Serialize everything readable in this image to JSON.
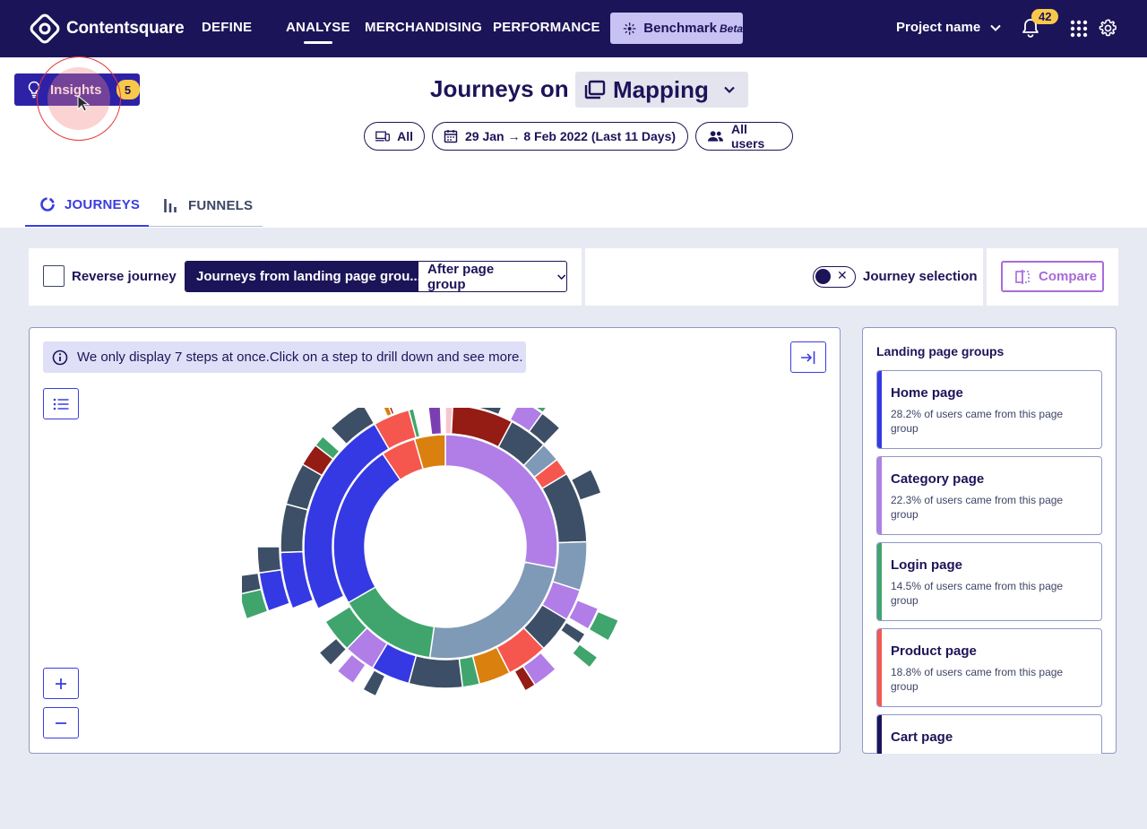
{
  "brand": {
    "name": "Contentsquare"
  },
  "nav": {
    "items": [
      "DEFINE",
      "ANALYSE",
      "MERCHANDISING",
      "PERFORMANCE"
    ],
    "active": "ANALYSE",
    "benchmark": {
      "label": "Benchmark",
      "tag": "Beta"
    },
    "project": "Project name",
    "notification_count": "42"
  },
  "insights": {
    "label": "Insights",
    "count": "5"
  },
  "header": {
    "title_prefix": "Journeys on",
    "mapping_label": "Mapping",
    "filters": {
      "device": "All",
      "date": "29 Jan → 8 Feb 2022 (Last 11 Days)",
      "segment": "All users"
    }
  },
  "tabs": {
    "journeys": "JOURNEYS",
    "funnels": "FUNNELS",
    "active": "JOURNEYS"
  },
  "toolbar": {
    "reverse_label": "Reverse journey",
    "journeys_from": "Journeys from landing page grou...",
    "after": "After page group",
    "journey_selection": "Journey selection",
    "compare": "Compare"
  },
  "info": {
    "message": "We only display 7 steps at once.Click on a step to drill down and see more."
  },
  "side": {
    "title": "Landing page groups",
    "groups": [
      {
        "name": "Home page",
        "desc": "28.2% of users came from this page group",
        "color": "#3539e3"
      },
      {
        "name": "Category page",
        "desc": "22.3% of users came from this page group",
        "color": "#b07ee6"
      },
      {
        "name": "Login page",
        "desc": "14.5% of users came from this page group",
        "color": "#3fa56c"
      },
      {
        "name": "Product page",
        "desc": "18.8% of users came from this page group",
        "color": "#f5574f"
      },
      {
        "name": "Cart page",
        "desc": "",
        "color": "#1c1458"
      }
    ]
  },
  "colors": {
    "nav_bg": "#1c1458",
    "accent": "#3a3ee0",
    "purple": "#a96bd8",
    "badge": "#f9c84a",
    "slate": "#3d4f66",
    "grey_blue": "#7f9ab6",
    "maroon": "#941c15",
    "orange": "#d9800f"
  },
  "sunburst": {
    "rings": [
      {
        "inner": 90,
        "outer": 125,
        "segments": [
          {
            "start": 0,
            "end": 101,
            "color": "#b07ee6"
          },
          {
            "start": 101,
            "end": 188,
            "color": "#7f9ab6"
          },
          {
            "start": 188,
            "end": 240,
            "color": "#3fa56c"
          },
          {
            "start": 240,
            "end": 326,
            "color": "#3539e3"
          },
          {
            "start": 326,
            "end": 344,
            "color": "#f5574f"
          },
          {
            "start": 344,
            "end": 360,
            "color": "#d9800f"
          }
        ]
      },
      {
        "inner": 126,
        "outer": 158,
        "segments": [
          {
            "start": 0,
            "end": 3,
            "color": "#f6c6cf"
          },
          {
            "start": 3,
            "end": 28,
            "color": "#941c15"
          },
          {
            "start": 28,
            "end": 44,
            "color": "#3d4f66"
          },
          {
            "start": 44,
            "end": 52,
            "color": "#7f9ab6"
          },
          {
            "start": 52,
            "end": 59,
            "color": "#f5574f"
          },
          {
            "start": 59,
            "end": 88,
            "color": "#3d4f66"
          },
          {
            "start": 88,
            "end": 108,
            "color": "#7f9ab6"
          },
          {
            "start": 108,
            "end": 121,
            "color": "#b07ee6"
          },
          {
            "start": 121,
            "end": 136,
            "color": "#3d4f66"
          },
          {
            "start": 136,
            "end": 153,
            "color": "#f5574f"
          },
          {
            "start": 153,
            "end": 166,
            "color": "#d9800f"
          },
          {
            "start": 166,
            "end": 173,
            "color": "#3fa56c"
          },
          {
            "start": 173,
            "end": 195,
            "color": "#3d4f66"
          },
          {
            "start": 195,
            "end": 211,
            "color": "#3539e3"
          },
          {
            "start": 211,
            "end": 224,
            "color": "#b07ee6"
          },
          {
            "start": 224,
            "end": 238,
            "color": "#3fa56c"
          },
          {
            "start": 244,
            "end": 330,
            "color": "#3539e3"
          },
          {
            "start": 330,
            "end": 345,
            "color": "#f5574f"
          },
          {
            "start": 345,
            "end": 347,
            "color": "#3fa56c"
          },
          {
            "start": 353,
            "end": 358,
            "color": "#7b3fb1"
          }
        ]
      },
      {
        "inner": 159,
        "outer": 184,
        "segments": [
          {
            "start": 0,
            "end": 22,
            "color": "#3d4f66"
          },
          {
            "start": 27,
            "end": 36,
            "color": "#b07ee6"
          },
          {
            "start": 36,
            "end": 44,
            "color": "#3d4f66"
          },
          {
            "start": 62,
            "end": 71,
            "color": "#3d4f66"
          },
          {
            "start": 112,
            "end": 120,
            "color": "#b07ee6"
          },
          {
            "start": 122,
            "end": 126,
            "color": "#3d4f66"
          },
          {
            "start": 138,
            "end": 147,
            "color": "#b07ee6"
          },
          {
            "start": 147,
            "end": 151,
            "color": "#941c15"
          },
          {
            "start": 205,
            "end": 210,
            "color": "#3d4f66"
          },
          {
            "start": 214,
            "end": 221,
            "color": "#b07ee6"
          },
          {
            "start": 224,
            "end": 230,
            "color": "#3d4f66"
          },
          {
            "start": 248,
            "end": 268,
            "color": "#3539e3"
          },
          {
            "start": 268,
            "end": 285,
            "color": "#3d4f66"
          },
          {
            "start": 285,
            "end": 300,
            "color": "#3d4f66"
          },
          {
            "start": 300,
            "end": 308,
            "color": "#941c15"
          },
          {
            "start": 308,
            "end": 312,
            "color": "#3fa56c"
          },
          {
            "start": 316,
            "end": 330,
            "color": "#3d4f66"
          },
          {
            "start": 336,
            "end": 338,
            "color": "#d9800f"
          },
          {
            "start": 338,
            "end": 339,
            "color": "#941c15"
          }
        ]
      },
      {
        "inner": 185,
        "outer": 210,
        "segments": [
          {
            "start": 29,
            "end": 36,
            "color": "#3fa56c"
          },
          {
            "start": 113,
            "end": 120,
            "color": "#3fa56c"
          },
          {
            "start": 126,
            "end": 130,
            "color": "#3fa56c"
          },
          {
            "start": 250,
            "end": 262,
            "color": "#3539e3"
          },
          {
            "start": 262,
            "end": 270,
            "color": "#3d4f66"
          }
        ]
      },
      {
        "inner": 211,
        "outer": 236,
        "segments": [
          {
            "start": 28,
            "end": 33,
            "color": "#2e7d4f"
          },
          {
            "start": 250,
            "end": 257,
            "color": "#3fa56c"
          },
          {
            "start": 257,
            "end": 262,
            "color": "#3d4f66"
          }
        ]
      }
    ]
  }
}
